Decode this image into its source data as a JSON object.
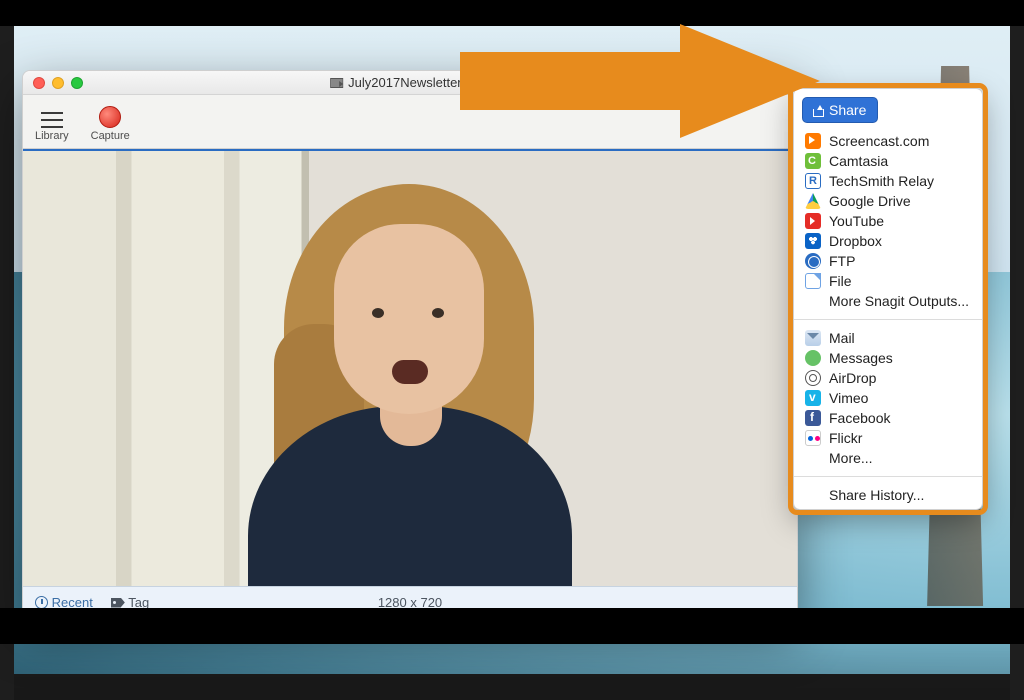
{
  "window": {
    "title": "July2017Newsletter.mp4"
  },
  "toolbar": {
    "library_label": "Library",
    "capture_label": "Capture"
  },
  "status": {
    "recent_label": "Recent",
    "tag_label": "Tag",
    "dimensions": "1280 x 720"
  },
  "share": {
    "button_label": "Share",
    "group1": [
      {
        "icon": "screencast-icon",
        "label": "Screencast.com"
      },
      {
        "icon": "camtasia-icon",
        "label": "Camtasia"
      },
      {
        "icon": "relay-icon",
        "label": "TechSmith Relay"
      },
      {
        "icon": "google-drive-icon",
        "label": "Google Drive"
      },
      {
        "icon": "youtube-icon",
        "label": "YouTube"
      },
      {
        "icon": "dropbox-icon",
        "label": "Dropbox"
      },
      {
        "icon": "ftp-icon",
        "label": "FTP"
      },
      {
        "icon": "file-icon",
        "label": "File"
      }
    ],
    "more_outputs_label": "More Snagit Outputs...",
    "group2": [
      {
        "icon": "mail-icon",
        "label": "Mail"
      },
      {
        "icon": "messages-icon",
        "label": "Messages"
      },
      {
        "icon": "airdrop-icon",
        "label": "AirDrop"
      },
      {
        "icon": "vimeo-icon",
        "label": "Vimeo"
      },
      {
        "icon": "facebook-icon",
        "label": "Facebook"
      },
      {
        "icon": "flickr-icon",
        "label": "Flickr"
      }
    ],
    "more_label": "More...",
    "history_label": "Share History..."
  },
  "annotation": {
    "arrow_color": "#e78b1d"
  }
}
